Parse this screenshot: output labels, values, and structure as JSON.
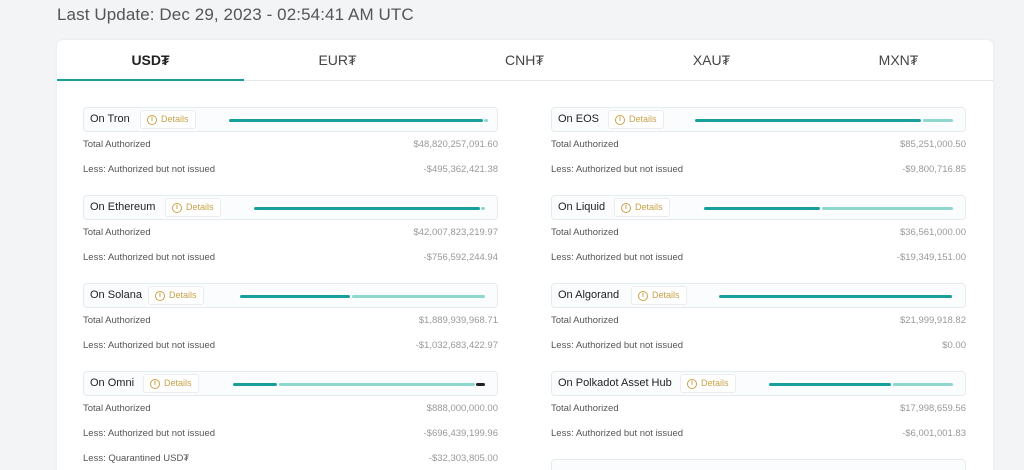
{
  "header": {
    "last_update": "Last Update: Dec 29, 2023 - 02:54:41 AM UTC"
  },
  "tabs": [
    {
      "label": "USD₮",
      "active": true
    },
    {
      "label": "EUR₮",
      "active": false
    },
    {
      "label": "CNH₮",
      "active": false
    },
    {
      "label": "XAU₮",
      "active": false
    },
    {
      "label": "MXN₮",
      "active": false
    }
  ],
  "colors": {
    "accent": "#17a09b",
    "light_accent": "#8ed8d0",
    "dark": "#222222",
    "details": "#c9a24a"
  },
  "details_label": "Details",
  "details_icon": "info-icon",
  "row_labels": {
    "total": "Total Authorized",
    "less": "Less: Authorized but not issued",
    "quarantined": "Less: Quarantined USD₮"
  },
  "left_chains": [
    {
      "name": "On Tron",
      "total": "$48,820,257,091.60",
      "less": "-$495,362,421.38"
    },
    {
      "name": "On Ethereum",
      "total": "$42,007,823,219.97",
      "less": "-$756,592,244.94"
    },
    {
      "name": "On Solana",
      "total": "$1,889,939,968.71",
      "less": "-$1,032,683,422.97"
    },
    {
      "name": "On Omni",
      "total": "$888,000,000.00",
      "less": "-$696,439,199.96",
      "quarantined": "-$32,303,805.00"
    }
  ],
  "right_chains": [
    {
      "name": "On EOS",
      "total": "$85,251,000.50",
      "less": "-$9,800,716.85"
    },
    {
      "name": "On Liquid",
      "total": "$36,561,000.00",
      "less": "-$19,349,151.00"
    },
    {
      "name": "On Algorand",
      "total": "$21,999,918.82",
      "less": "$0.00"
    },
    {
      "name": "On Polkadot Asset Hub",
      "total": "$17,998,659.56",
      "less": "-$6,001,001.83"
    }
  ]
}
